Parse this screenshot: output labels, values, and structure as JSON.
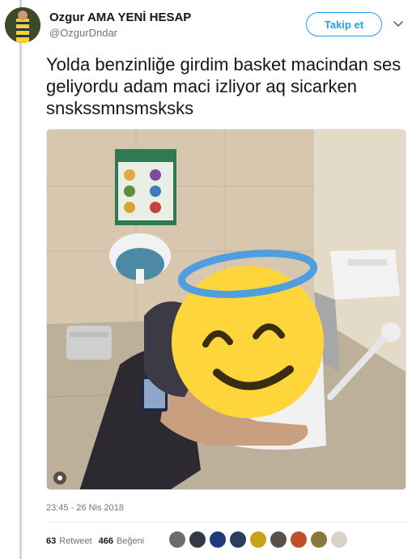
{
  "author": {
    "name": "Ozgur AMA YENİ HESAP",
    "handle": "@OzgurDndar"
  },
  "follow_button": {
    "label": "Takip et"
  },
  "tweet": {
    "text": "Yolda benzinliğe girdim basket macindan ses geliyordu adam maci izliyor aq sicarken snskssmnsmsksks",
    "timestamp": "23:45 - 26 Nis 2018"
  },
  "stats": {
    "retweets": "63",
    "retweets_label": "Retweet",
    "likes": "466",
    "likes_label": "Beğeni"
  },
  "icons": {
    "menu": "chevron-down-icon",
    "media_badge": "gif-badge-icon"
  },
  "colors": {
    "accent": "#1da1f2",
    "secondary_text": "#657786",
    "primary_text": "#14171a"
  }
}
